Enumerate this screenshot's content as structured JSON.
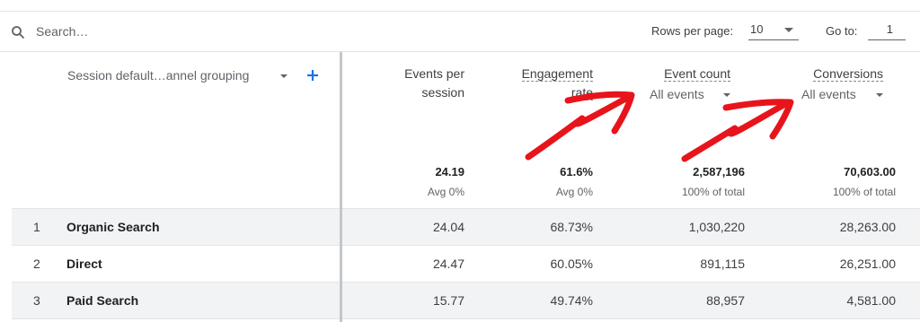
{
  "toolbar": {
    "search_icon": "search-icon",
    "search_placeholder": "Search…",
    "rows_per_page_label": "Rows per page:",
    "rows_per_page_value": "10",
    "go_to_label": "Go to:",
    "go_to_value": "1"
  },
  "table": {
    "dimension_header": "Session default…annel grouping",
    "columns": [
      {
        "line1": "Events per",
        "line2": "session",
        "total": "24.19",
        "total_sub": "Avg 0%"
      },
      {
        "line1": "Engagement",
        "line2": "rate",
        "total": "61.6%",
        "total_sub": "Avg 0%"
      },
      {
        "line1": "Event count",
        "selector": "All events",
        "total": "2,587,196",
        "total_sub": "100% of total"
      },
      {
        "line1": "Conversions",
        "selector": "All events",
        "total": "70,603.00",
        "total_sub": "100% of total"
      }
    ],
    "rows": [
      {
        "index": "1",
        "name": "Organic Search",
        "values": [
          "24.04",
          "68.73%",
          "1,030,220",
          "28,263.00"
        ]
      },
      {
        "index": "2",
        "name": "Direct",
        "values": [
          "24.47",
          "60.05%",
          "891,115",
          "26,251.00"
        ]
      },
      {
        "index": "3",
        "name": "Paid Search",
        "values": [
          "15.77",
          "49.74%",
          "88,957",
          "4,581.00"
        ]
      }
    ]
  },
  "colors": {
    "accent": "#1a73e8",
    "annotation_red": "#e8141b",
    "row_shade": "#f1f3f4"
  }
}
